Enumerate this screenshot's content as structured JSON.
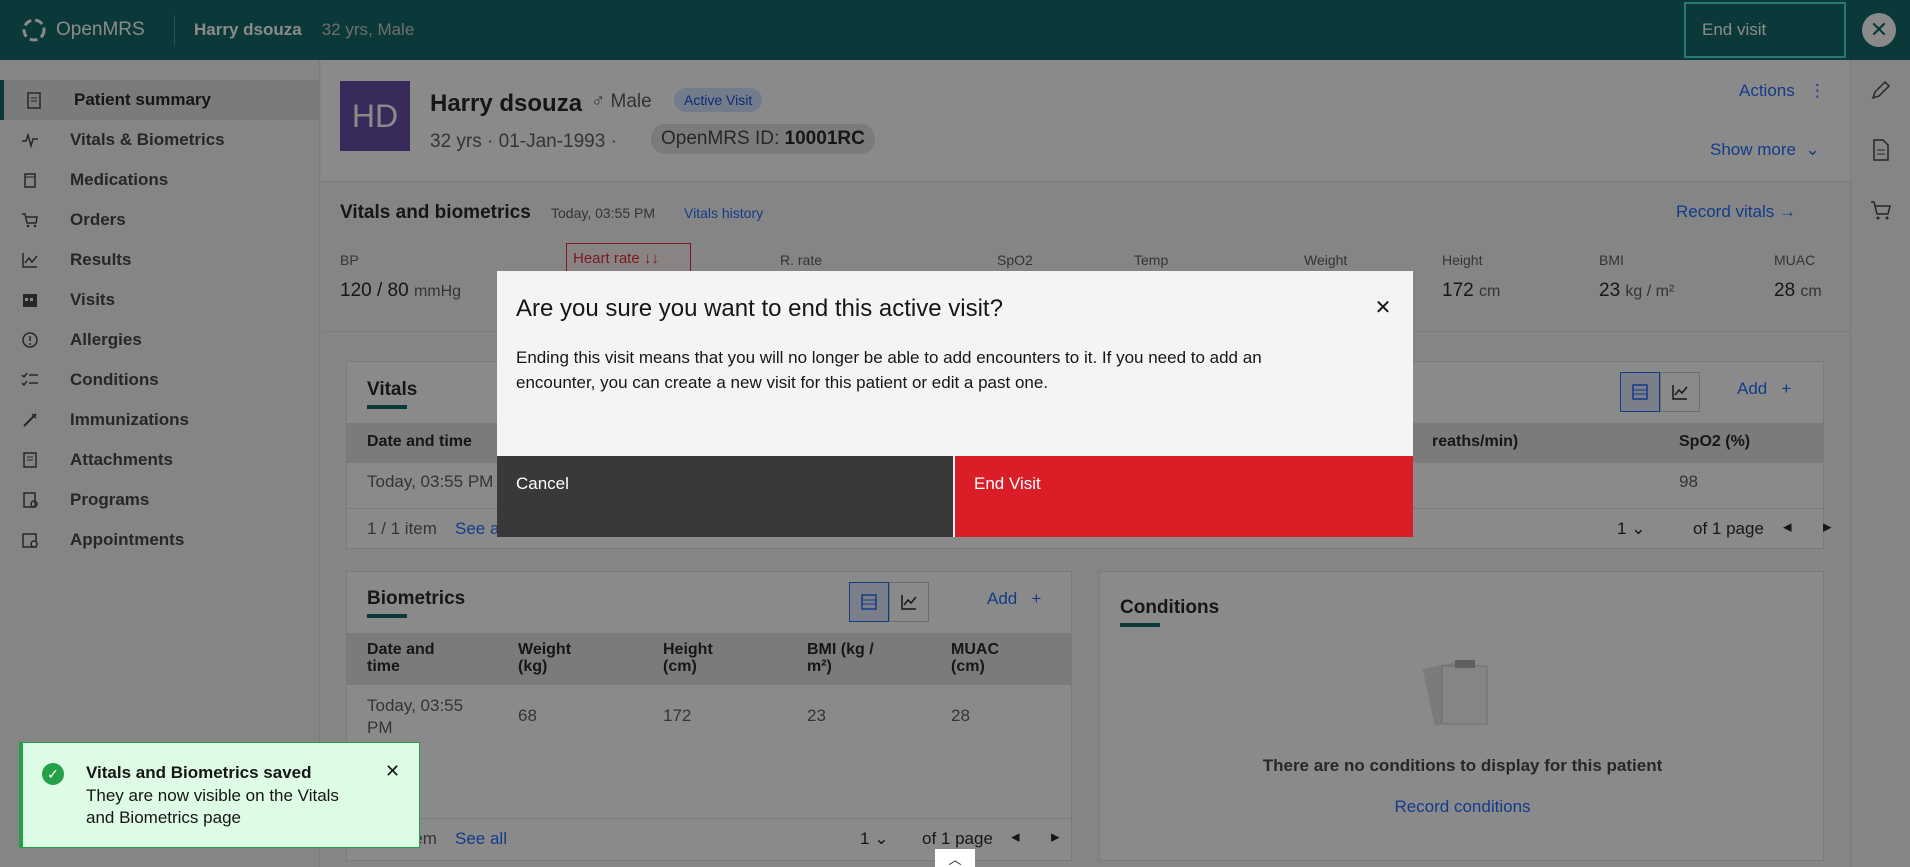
{
  "header": {
    "app_name": "OpenMRS",
    "patient_name": "Harry dsouza",
    "patient_meta": "32 yrs, Male",
    "end_visit_label": "End visit",
    "close_symbol": "✕"
  },
  "sidebar": {
    "items": [
      {
        "label": "Patient summary",
        "icon": "clipboard-icon"
      },
      {
        "label": "Vitals & Biometrics",
        "icon": "activity-icon"
      },
      {
        "label": "Medications",
        "icon": "pill-icon"
      },
      {
        "label": "Orders",
        "icon": "cart-icon"
      },
      {
        "label": "Results",
        "icon": "chart-line-icon"
      },
      {
        "label": "Visits",
        "icon": "calendar-icon"
      },
      {
        "label": "Allergies",
        "icon": "warning-icon"
      },
      {
        "label": "Conditions",
        "icon": "checklist-icon"
      },
      {
        "label": "Immunizations",
        "icon": "syringe-icon"
      },
      {
        "label": "Attachments",
        "icon": "attachment-icon"
      },
      {
        "label": "Programs",
        "icon": "program-icon"
      },
      {
        "label": "Appointments",
        "icon": "appointment-icon"
      }
    ]
  },
  "banner": {
    "initials": "HD",
    "name": "Harry dsouza",
    "gender": "♂ Male",
    "visit_tag": "Active Visit",
    "age_dob": "32 yrs · 01-Jan-1993 ·",
    "id_label": "OpenMRS ID:",
    "id_value": "10001RC",
    "actions_label": "Actions",
    "show_more_label": "Show more"
  },
  "vitals_strip": {
    "title": "Vitals and biometrics",
    "time": "Today, 03:55 PM",
    "history_link": "Vitals history",
    "record_link": "Record vitals →",
    "heart_rate_label": "Heart rate ↓↓",
    "labels": {
      "bp": "BP",
      "rrate": "R. rate",
      "spo2": "SpO2",
      "temp": "Temp",
      "weight": "Weight",
      "height": "Height",
      "bmi": "BMI",
      "muac": "MUAC"
    },
    "values": {
      "bp": "120 / 80",
      "bp_unit": "mmHg",
      "height": "172",
      "height_unit": "cm",
      "bmi": "23",
      "bmi_unit": "kg / m²",
      "muac": "28",
      "muac_unit": "cm"
    }
  },
  "vitals_card": {
    "title": "Vitals",
    "add_label": "Add",
    "col_date": "Date and time",
    "col_rr": "reaths/min)",
    "col_spo2": "SpO2 (%)",
    "row_date": "Today, 03:55 PM",
    "row_spo2": "98",
    "footer_count": "1 / 1 item",
    "see_all": "See a",
    "page_select": "1",
    "page_of": "of 1 page"
  },
  "biometrics_card": {
    "title": "Biometrics",
    "add_label": "Add",
    "cols": [
      "Date and time",
      "Weight (kg)",
      "Height (cm)",
      "BMI (kg / m²)",
      "MUAC (cm)"
    ],
    "row": [
      "Today, 03:55 PM",
      "68",
      "172",
      "23",
      "28"
    ],
    "footer_count": "1 / 1 item",
    "see_all": "See all",
    "page_select": "1",
    "page_of": "of 1 page"
  },
  "conditions_card": {
    "title": "Conditions",
    "empty_text": "There are no conditions to display for this patient",
    "record_link": "Record conditions"
  },
  "modal": {
    "title": "Are you sure you want to end this active visit?",
    "body": "Ending this visit means that you will no longer be able to add encounters to it. If you need to add an encounter, you can create a new visit for this patient or edit a past one.",
    "cancel_label": "Cancel",
    "confirm_label": "End Visit"
  },
  "toast": {
    "title": "Vitals and Biometrics saved",
    "subtitle": "They are now visible on the Vitals and Biometrics page"
  },
  "colors": {
    "header_bg": "#005d5d",
    "danger": "#da1e28",
    "link": "#0f62fe",
    "success": "#24a148"
  }
}
